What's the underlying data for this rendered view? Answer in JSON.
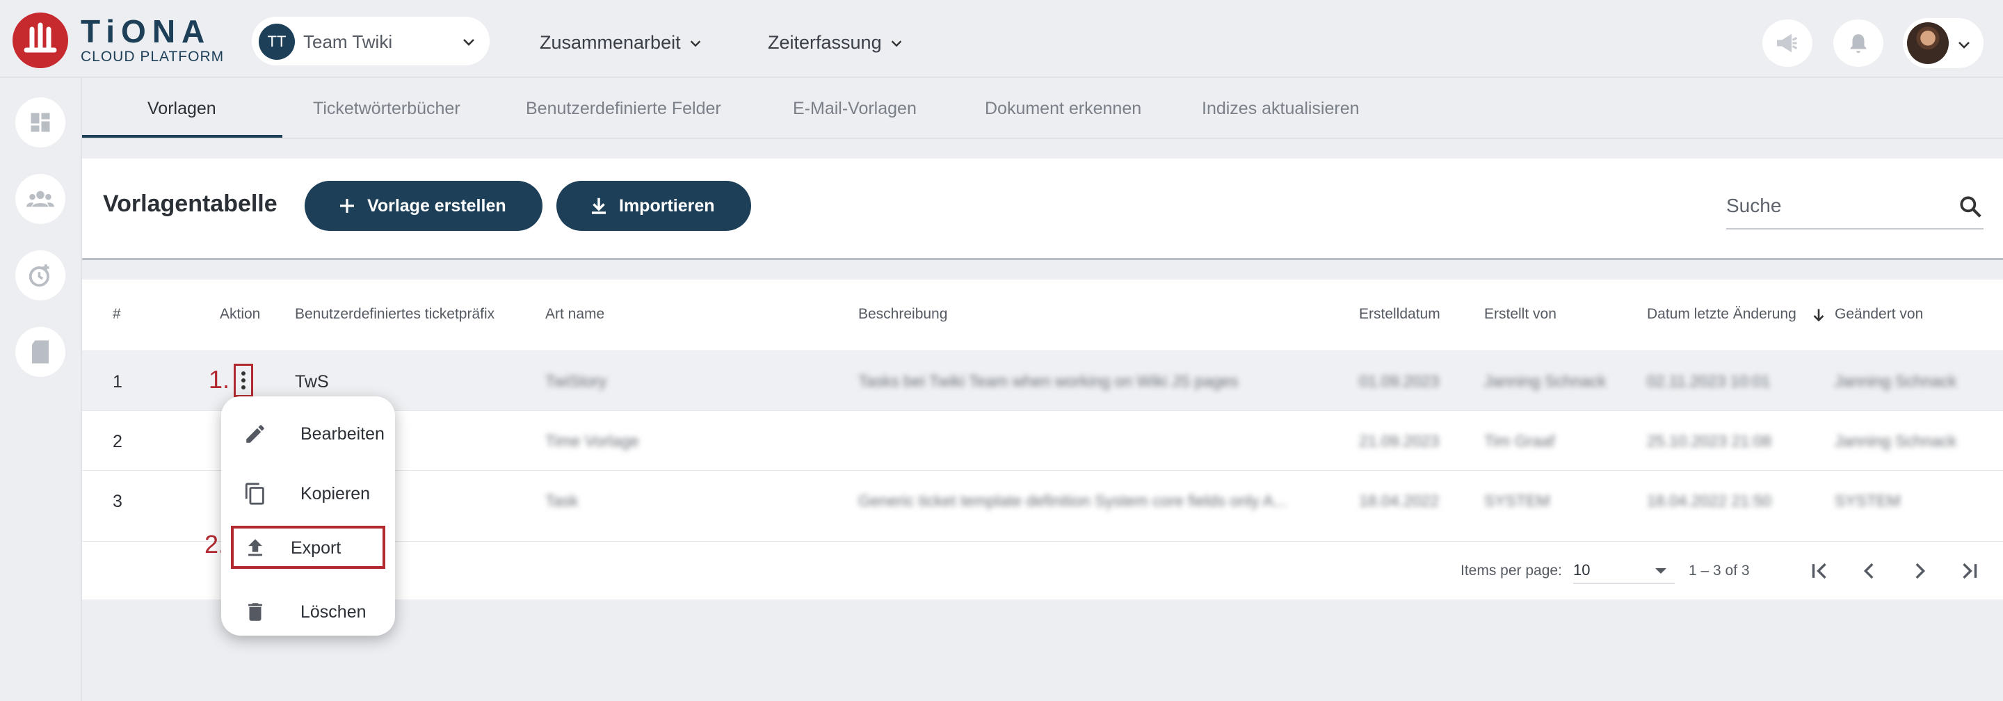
{
  "brand": {
    "name": "TiONA",
    "subtitle": "CLOUD PLATFORM",
    "color": "#c62a2f"
  },
  "team": {
    "initials": "TT",
    "name": "Team Twiki"
  },
  "nav": [
    {
      "label": "Zusammenarbeit"
    },
    {
      "label": "Zeiterfassung"
    }
  ],
  "header_icons": [
    "megaphone-icon",
    "bell-icon",
    "user-avatar"
  ],
  "rail_icons": [
    "dashboard-icon",
    "people-icon",
    "timer-icon",
    "document-icon"
  ],
  "tabs": [
    {
      "label": "Vorlagen",
      "active": true
    },
    {
      "label": "Ticketwörterbücher"
    },
    {
      "label": "Benutzerdefinierte Felder"
    },
    {
      "label": "E-Mail-Vorlagen"
    },
    {
      "label": "Dokument erkennen"
    },
    {
      "label": "Indizes aktualisieren"
    }
  ],
  "toolbar": {
    "title": "Vorlagentabelle",
    "create_label": "Vorlage erstellen",
    "import_label": "Importieren",
    "search_placeholder": "Suche"
  },
  "table": {
    "columns": [
      "#",
      "Aktion",
      "Benutzerdefiniertes ticketpräfix",
      "Art name",
      "Beschreibung",
      "Erstelldatum",
      "Erstellt von",
      "Datum letzte Änderung",
      "Geändert von"
    ],
    "rows": [
      {
        "num": "1",
        "prefix": "TwS",
        "art": "TwiStory",
        "desc": "Tasks bei Twiki Team when working on Wiki JS pages",
        "created": "01.09.2023",
        "created_by": "Janning Schnack",
        "modified": "02.11.2023 10:01",
        "modified_by": "Janning Schnack"
      },
      {
        "num": "2",
        "prefix": "",
        "art": "Time Vorlage",
        "desc": "",
        "created": "21.09.2023",
        "created_by": "Tim Graaf",
        "modified": "25.10.2023 21:08",
        "modified_by": "Janning Schnack"
      },
      {
        "num": "3",
        "prefix": "",
        "art": "Task",
        "desc": "Generic ticket template definition System core fields only A...",
        "created": "18.04.2022",
        "created_by": "SYSTEM",
        "modified": "18.04.2022 21:50",
        "modified_by": "SYSTEM"
      }
    ],
    "pager": {
      "items_per_page_label": "Items per page:",
      "items_per_page": "10",
      "range": "1 – 3 of 3"
    }
  },
  "context_menu": {
    "items": [
      {
        "label": "Bearbeiten",
        "icon": "pencil-icon"
      },
      {
        "label": "Kopieren",
        "icon": "copy-icon"
      },
      {
        "label": "Export",
        "icon": "upload-icon"
      },
      {
        "label": "Löschen",
        "icon": "trash-icon"
      }
    ]
  },
  "annotations": {
    "step1": "1.",
    "step2": "2."
  },
  "colors": {
    "primary": "#1d3f58",
    "annotation": "#b22a2f"
  }
}
